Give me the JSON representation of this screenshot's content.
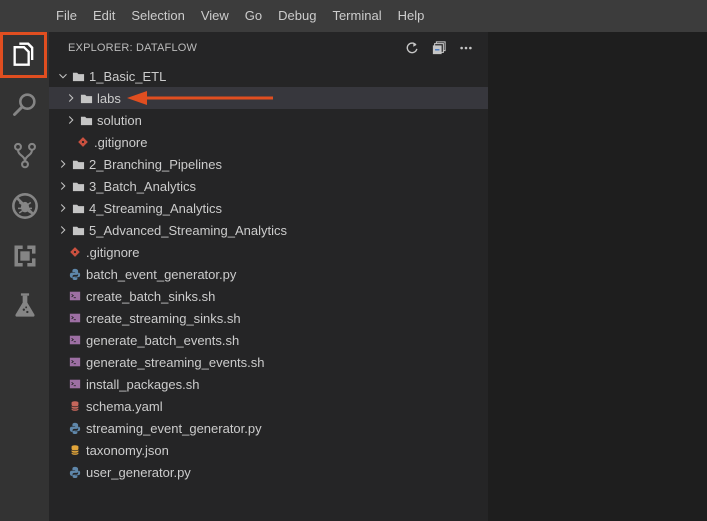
{
  "menubar": {
    "items": [
      "File",
      "Edit",
      "Selection",
      "View",
      "Go",
      "Debug",
      "Terminal",
      "Help"
    ]
  },
  "activitybar": {
    "items": [
      {
        "name": "explorer",
        "icon": "files-icon",
        "selected": true
      },
      {
        "name": "search",
        "icon": "search-icon",
        "selected": false
      },
      {
        "name": "source-control",
        "icon": "source-control-icon",
        "selected": false
      },
      {
        "name": "debug",
        "icon": "no-bug-icon",
        "selected": false
      },
      {
        "name": "extensions",
        "icon": "extensions-icon",
        "selected": false
      },
      {
        "name": "test",
        "icon": "flask-icon",
        "selected": false
      }
    ],
    "highlight_color": "#e04e20"
  },
  "sidebar": {
    "title": "EXPLORER: DATAFLOW",
    "actions": [
      {
        "name": "refresh",
        "icon": "refresh-icon"
      },
      {
        "name": "collapse-all",
        "icon": "collapse-all-icon"
      },
      {
        "name": "more",
        "icon": "ellipsis-icon"
      }
    ],
    "tree": [
      {
        "label": "1_Basic_ETL",
        "type": "folder",
        "expanded": true,
        "depth": 0
      },
      {
        "label": "labs",
        "type": "folder",
        "expanded": false,
        "depth": 1,
        "selected": true
      },
      {
        "label": "solution",
        "type": "folder",
        "expanded": false,
        "depth": 1
      },
      {
        "label": ".gitignore",
        "type": "git",
        "depth": 1
      },
      {
        "label": "2_Branching_Pipelines",
        "type": "folder",
        "expanded": false,
        "depth": 0
      },
      {
        "label": "3_Batch_Analytics",
        "type": "folder",
        "expanded": false,
        "depth": 0
      },
      {
        "label": "4_Streaming_Analytics",
        "type": "folder",
        "expanded": false,
        "depth": 0
      },
      {
        "label": "5_Advanced_Streaming_Analytics",
        "type": "folder",
        "expanded": false,
        "depth": 0
      },
      {
        "label": ".gitignore",
        "type": "git",
        "depth": 0
      },
      {
        "label": "batch_event_generator.py",
        "type": "python",
        "depth": 0
      },
      {
        "label": "create_batch_sinks.sh",
        "type": "shell",
        "depth": 0
      },
      {
        "label": "create_streaming_sinks.sh",
        "type": "shell",
        "depth": 0
      },
      {
        "label": "generate_batch_events.sh",
        "type": "shell",
        "depth": 0
      },
      {
        "label": "generate_streaming_events.sh",
        "type": "shell",
        "depth": 0
      },
      {
        "label": "install_packages.sh",
        "type": "shell",
        "depth": 0
      },
      {
        "label": "schema.yaml",
        "type": "yaml",
        "depth": 0
      },
      {
        "label": "streaming_event_generator.py",
        "type": "python",
        "depth": 0
      },
      {
        "label": "taxonomy.json",
        "type": "json",
        "depth": 0
      },
      {
        "label": "user_generator.py",
        "type": "python",
        "depth": 0
      }
    ]
  },
  "annotation": {
    "arrow_color": "#e04e20",
    "points_to": "labs"
  },
  "colors": {
    "git": "#c9503f",
    "python": "#5f87aa",
    "shell": "#9d6fa3",
    "yaml": "#c5665b",
    "json": "#e1a53a",
    "folder": "#c5c5c5"
  }
}
